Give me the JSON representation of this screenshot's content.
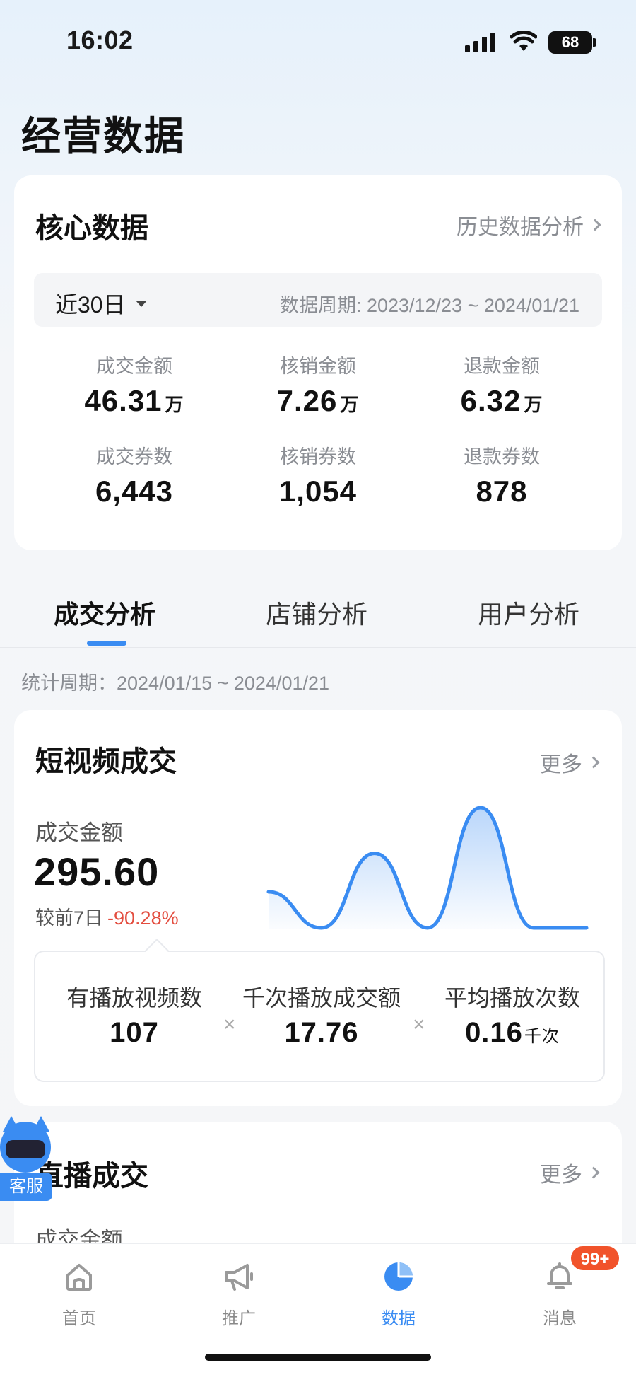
{
  "status": {
    "time": "16:02",
    "battery": "68"
  },
  "page": {
    "title": "经营数据"
  },
  "core": {
    "title": "核心数据",
    "history_link": "历史数据分析",
    "period_select": "近30日",
    "period_range": "数据周期: 2023/12/23 ~ 2024/01/21",
    "metrics": [
      {
        "label": "成交金额",
        "value": "46.31",
        "unit": "万"
      },
      {
        "label": "核销金额",
        "value": "7.26",
        "unit": "万"
      },
      {
        "label": "退款金额",
        "value": "6.32",
        "unit": "万"
      },
      {
        "label": "成交券数",
        "value": "6,443",
        "unit": ""
      },
      {
        "label": "核销券数",
        "value": "1,054",
        "unit": ""
      },
      {
        "label": "退款券数",
        "value": "878",
        "unit": ""
      }
    ]
  },
  "tabs": [
    "成交分析",
    "店铺分析",
    "用户分析"
  ],
  "stat_period": "统计周期：2024/01/15 ~ 2024/01/21",
  "video": {
    "title": "短视频成交",
    "more": "更多",
    "amount_label": "成交金额",
    "amount_value": "295.60",
    "compare_label": "较前7日",
    "compare_value": "-90.28%",
    "trend": [
      0.3,
      0.0,
      0.62,
      0.0,
      1.0,
      0.0,
      0.0
    ],
    "accent_color": "#3a8cf2",
    "formula": [
      {
        "label": "有播放视频数",
        "value": "107",
        "unit": ""
      },
      {
        "label": "千次播放成交额",
        "value": "17.76",
        "unit": ""
      },
      {
        "label": "平均播放次数",
        "value": "0.16",
        "unit": "千次"
      }
    ],
    "times_symbol": "×"
  },
  "live": {
    "title": "直播成交",
    "more": "更多",
    "amount_label": "成交金额"
  },
  "service": {
    "label": "客服"
  },
  "nav": [
    {
      "label": "首页",
      "icon": "home-icon"
    },
    {
      "label": "推广",
      "icon": "megaphone-icon"
    },
    {
      "label": "数据",
      "icon": "pie-chart-icon"
    },
    {
      "label": "消息",
      "icon": "bell-icon"
    }
  ],
  "badge": "99+"
}
